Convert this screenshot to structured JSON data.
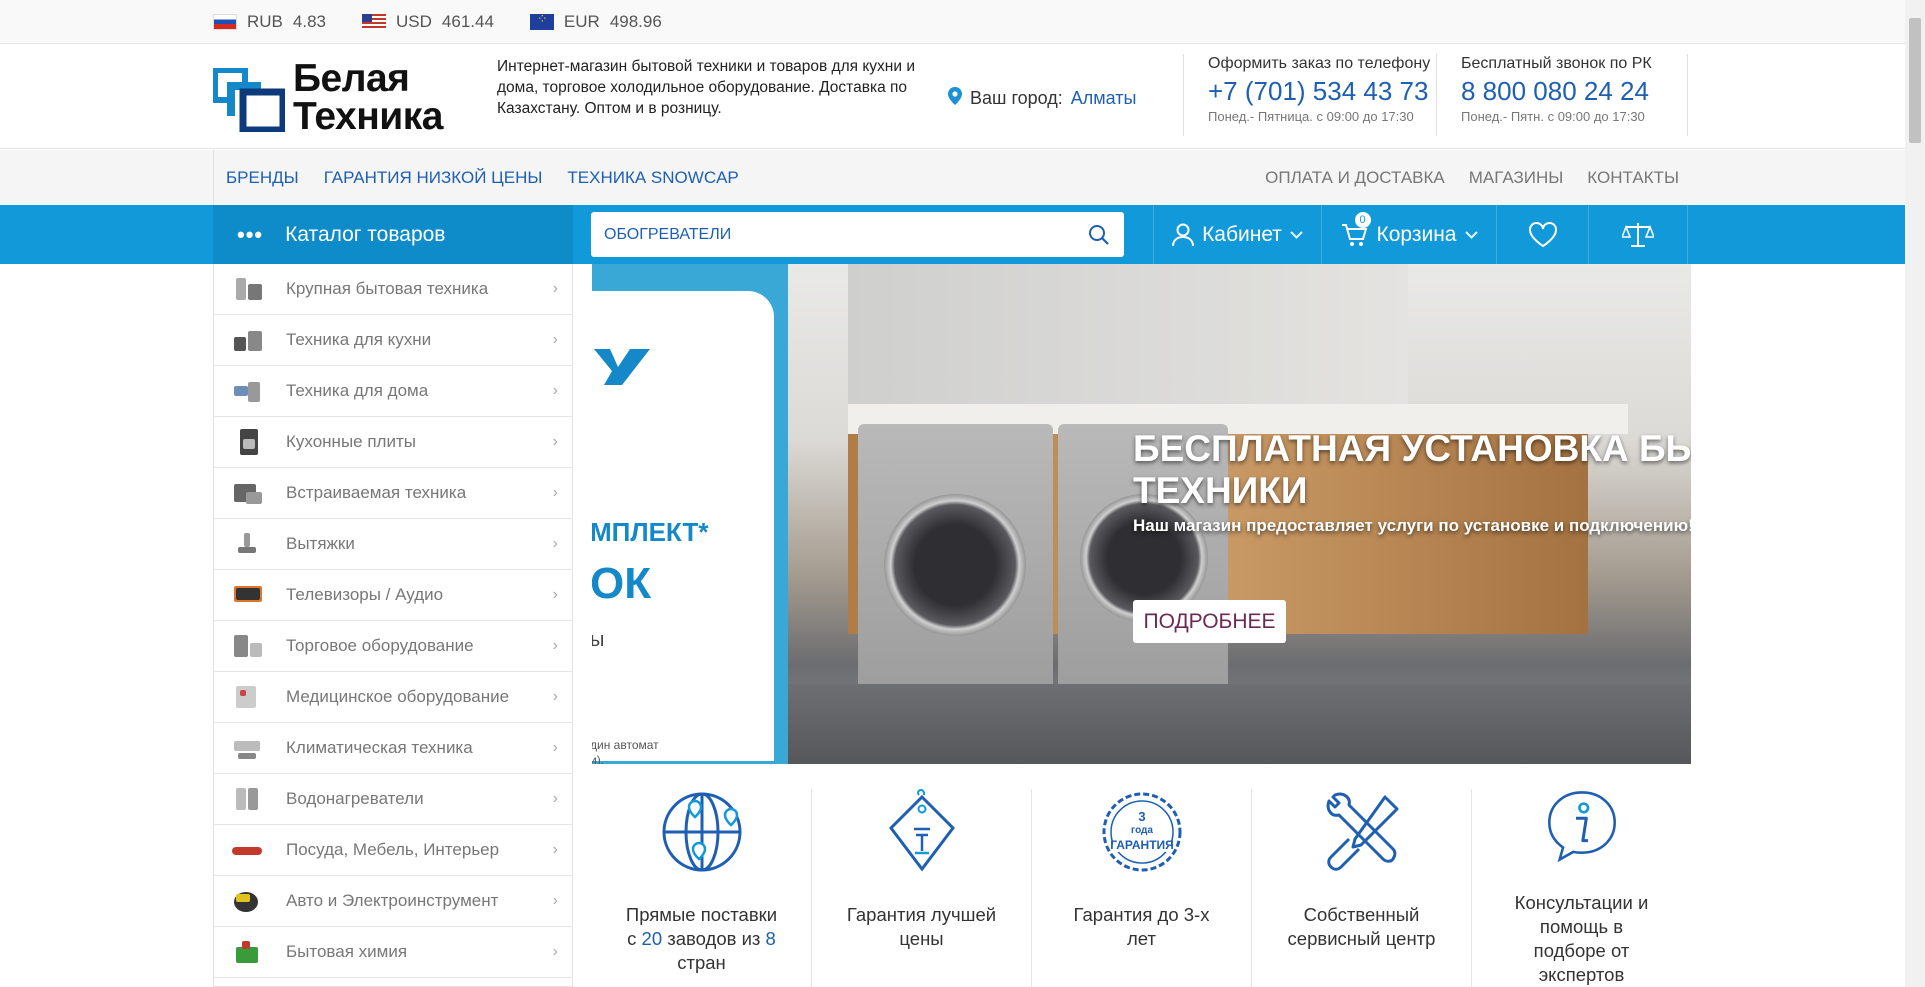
{
  "currency": [
    {
      "code": "RUB",
      "value": "4.83",
      "flag": "ru-flag"
    },
    {
      "code": "USD",
      "value": "461.44",
      "flag": "us-flag"
    },
    {
      "code": "EUR",
      "value": "498.96",
      "flag": "eu-flag"
    }
  ],
  "header": {
    "logo_line1": "Белая",
    "logo_line2": "Техника",
    "tagline": "Интернет-магазин бытовой техники и товаров для кухни и дома, торговое холодильное оборудование. Доставка по Казахстану. Оптом и в розницу.",
    "city_label": "Ваш город:",
    "city_value": "Алматы",
    "phone1_label": "Оформить заказ по телефону",
    "phone1_number": "+7 (701) 534 43 73",
    "phone1_hours": "Понед.- Пятница. с 09:00 до 17:30",
    "phone2_label": "Бесплатный звонок по РК",
    "phone2_number": "8 800 080 24 24",
    "phone2_hours": "Понед.- Пятн. с 09:00 до 17:30"
  },
  "topnav": {
    "left": [
      "БРЕНДЫ",
      "ГАРАНТИЯ НИЗКОЙ ЦЕНЫ",
      "ТЕХНИКА SNOWCAP"
    ],
    "right": [
      "ОПЛАТА И ДОСТАВКА",
      "МАГАЗИНЫ",
      "КОНТАКТЫ"
    ]
  },
  "mainbar": {
    "catalog_label": "Каталог товаров",
    "search_value": "ОБОГРЕВАТЕЛИ",
    "cabinet_label": "Кабинет",
    "cart_label": "Корзина",
    "cart_count": "0"
  },
  "catalog": [
    "Крупная бытовая техника",
    "Техника для кухни",
    "Техника для дома",
    "Кухонные плиты",
    "Встраиваемая техника",
    "Вытяжки",
    "Телевизоры / Аудио",
    "Торговое оборудование",
    "Медицинское оборудование",
    "Климатическая техника",
    "Водонагреватели",
    "Посуда, Мебель, Интерьер",
    "Авто и Электроинструмент",
    "Бытовая химия"
  ],
  "banner": {
    "title_line1": "БЕСПЛАТНАЯ УСТАНОВКА БЫТОВОЙ",
    "title_line2": "ТЕХНИКИ",
    "subtitle": "Наш магазин предоставляет услуги по установке и подключению!",
    "button": "ПОДРОБНЕЕ",
    "side_text1": "МПЛЕКТ*",
    "side_text2": "ОК",
    "side_text3": "ы",
    "side_small": "дин автомат",
    "side_small2": "и)."
  },
  "features": [
    {
      "icon": "globe-icon",
      "text_a": "Прямые поставки с ",
      "hl_a": "20",
      "text_b": " заводов из ",
      "hl_b": "8",
      "text_c": " стран"
    },
    {
      "icon": "price-tag-icon",
      "text": "Гарантия лучшей цены"
    },
    {
      "icon": "warranty-seal-icon",
      "text": "Гарантия до 3-х лет",
      "seal_top": "3",
      "seal_mid": "года",
      "seal_bottom": "ГАРАНТИЯ"
    },
    {
      "icon": "tools-icon",
      "text": "Собственный сервисный центр"
    },
    {
      "icon": "info-icon",
      "text": "Консультации и помощь в подборе от экспертов"
    }
  ]
}
